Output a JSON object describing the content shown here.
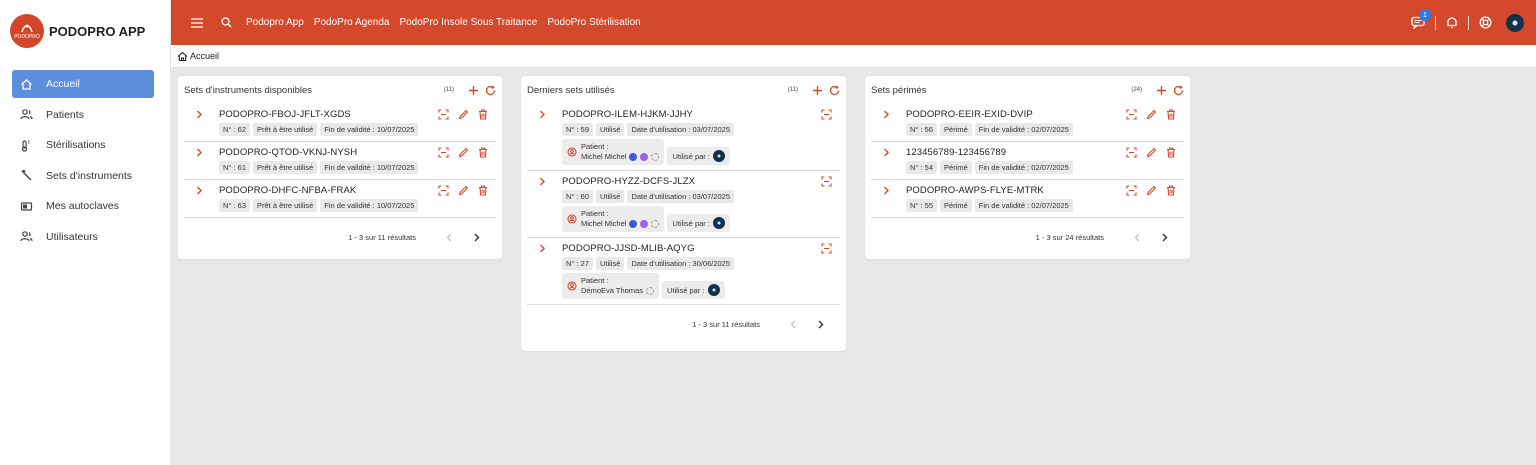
{
  "app": {
    "logo_text": "PODOPRO APP",
    "logo_badge": "PODOPRO"
  },
  "topbar": {
    "links": [
      "Podopro App",
      "PodoPro Agenda",
      "PodoPro Insole Sous Traitance",
      "PodoPro Stérilisation"
    ],
    "notification_count": "1"
  },
  "sidebar": {
    "items": [
      {
        "label": "Accueil",
        "icon": "home-icon"
      },
      {
        "label": "Patients",
        "icon": "users-icon"
      },
      {
        "label": "Stérilisations",
        "icon": "thermometer-icon"
      },
      {
        "label": "Sets d'instruments",
        "icon": "tools-icon"
      },
      {
        "label": "Mes autoclaves",
        "icon": "autoclave-icon"
      },
      {
        "label": "Utilisateurs",
        "icon": "users-icon"
      }
    ]
  },
  "breadcrumb": {
    "label": "Accueil"
  },
  "cards": {
    "available": {
      "title": "Sets d'instruments disponibles",
      "count": "(11)",
      "rows": [
        {
          "name": "PODOPRO-FBOJ-JFLT-XGDS",
          "number": "N° : 62",
          "status": "Prêt à être utilisé",
          "validity": "Fin de validité : 10/07/2025"
        },
        {
          "name": "PODOPRO-QTOD-VKNJ-NYSH",
          "number": "N° : 61",
          "status": "Prêt à être utilisé",
          "validity": "Fin de validité : 10/07/2025"
        },
        {
          "name": "PODOPRO-DHFC-NFBA-FRAK",
          "number": "N° : 63",
          "status": "Prêt à être utilisé",
          "validity": "Fin de validité : 10/07/2025"
        }
      ],
      "pager": "1 - 3 sur 11 résultats"
    },
    "last_used": {
      "title": "Derniers sets utilisés",
      "count": "(11)",
      "patient_label": "Patient :",
      "used_by_label": "Utilisé par :",
      "rows": [
        {
          "name": "PODOPRO-ILEM-HJKM-JJHY",
          "number": "N° : 59",
          "status": "Utilisé",
          "date": "Date d'utilisation : 03/07/2025",
          "patient": "Michel Michel"
        },
        {
          "name": "PODOPRO-HYZZ-DCFS-JLZX",
          "number": "N° : 60",
          "status": "Utilisé",
          "date": "Date d'utilisation : 03/07/2025",
          "patient": "Michel Michel"
        },
        {
          "name": "PODOPRO-JJSD-MLIB-AQYG",
          "number": "N° : 27",
          "status": "Utilisé",
          "date": "Date d'utilisation : 30/06/2025",
          "patient": "DémoEva Thomas"
        }
      ],
      "pager": "1 - 3 sur 11 résultats"
    },
    "expired": {
      "title": "Sets périmés",
      "count": "(24)",
      "rows": [
        {
          "name": "PODOPRO-EEIR-EXID-DVIP",
          "number": "N° : 56",
          "status": "Périmé",
          "validity": "Fin de validité : 02/07/2025"
        },
        {
          "name": "123456789-123456789",
          "number": "N° : 54",
          "status": "Périmé",
          "validity": "Fin de validité : 02/07/2025"
        },
        {
          "name": "PODOPRO-AWPS-FLYE-MTRK",
          "number": "N° : 55",
          "status": "Périmé",
          "validity": "Fin de validité : 02/07/2025"
        }
      ],
      "pager": "1 - 3 sur 24 résultats"
    }
  },
  "colors": {
    "primary": "#d4482c",
    "active_nav": "#5b8fdc",
    "background": "#e8e8e8"
  }
}
